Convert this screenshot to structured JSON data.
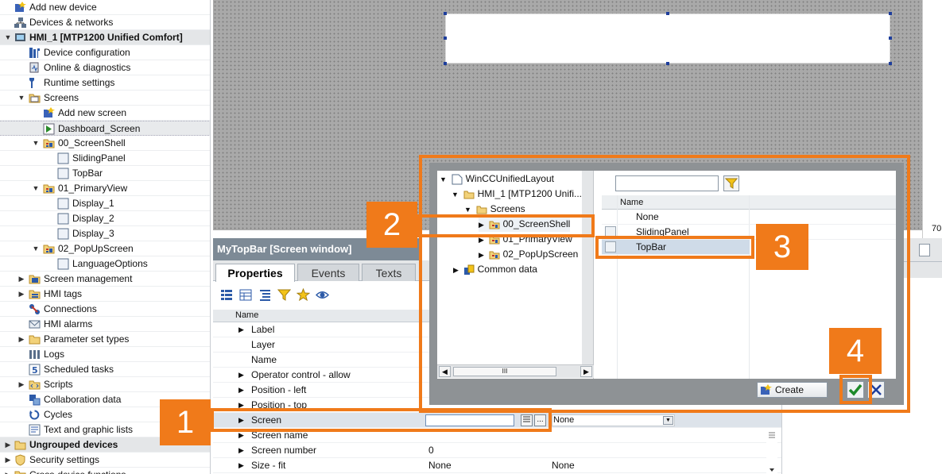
{
  "tree": {
    "items": [
      {
        "label": "Add new device",
        "icon": "add-device-icon"
      },
      {
        "label": "Devices & networks",
        "icon": "devices-networks-icon"
      },
      {
        "label": "HMI_1 [MTP1200 Unified Comfort]",
        "icon": "hmi-device-icon"
      },
      {
        "label": "Device configuration",
        "icon": "device-config-icon"
      },
      {
        "label": "Online & diagnostics",
        "icon": "diagnostics-icon"
      },
      {
        "label": "Runtime settings",
        "icon": "runtime-settings-icon"
      },
      {
        "label": "Screens",
        "icon": "folder-icon"
      },
      {
        "label": "Add new screen",
        "icon": "add-screen-icon"
      },
      {
        "label": "Dashboard_Screen",
        "icon": "screen-start-icon"
      },
      {
        "label": "00_ScreenShell",
        "icon": "screen-group-icon"
      },
      {
        "label": "SlidingPanel",
        "icon": "screen-icon"
      },
      {
        "label": "TopBar",
        "icon": "screen-icon"
      },
      {
        "label": "01_PrimaryView",
        "icon": "screen-group-icon"
      },
      {
        "label": "Display_1",
        "icon": "screen-icon"
      },
      {
        "label": "Display_2",
        "icon": "screen-icon"
      },
      {
        "label": "Display_3",
        "icon": "screen-icon"
      },
      {
        "label": "02_PopUpScreen",
        "icon": "screen-group-icon"
      },
      {
        "label": "LanguageOptions",
        "icon": "screen-icon"
      },
      {
        "label": "Screen management",
        "icon": "screen-management-icon"
      },
      {
        "label": "HMI tags",
        "icon": "hmi-tags-icon"
      },
      {
        "label": "Connections",
        "icon": "connections-icon"
      },
      {
        "label": "HMI alarms",
        "icon": "hmi-alarms-icon"
      },
      {
        "label": "Parameter set types",
        "icon": "folder-icon"
      },
      {
        "label": "Logs",
        "icon": "logs-icon"
      },
      {
        "label": "Scheduled tasks",
        "icon": "scheduled-tasks-icon"
      },
      {
        "label": "Scripts",
        "icon": "scripts-icon"
      },
      {
        "label": "Collaboration data",
        "icon": "collaboration-icon"
      },
      {
        "label": "Cycles",
        "icon": "cycles-icon"
      },
      {
        "label": "Text and graphic lists",
        "icon": "text-lists-icon"
      },
      {
        "label": "Ungrouped devices",
        "icon": "ungrouped-devices-icon"
      },
      {
        "label": "Security settings",
        "icon": "security-icon"
      },
      {
        "label": "Cross-device functions",
        "icon": "cross-device-icon"
      }
    ]
  },
  "canvas": {
    "zoom_text": "70"
  },
  "inspector": {
    "title": "MyTopBar [Screen window]",
    "tabs": [
      "Properties",
      "Events",
      "Texts"
    ],
    "col_name": "Name",
    "props": [
      {
        "name": "Label",
        "v1": "",
        "v2": ""
      },
      {
        "name": "Layer",
        "v1": "",
        "v2": ""
      },
      {
        "name": "Name",
        "v1": "",
        "v2": ""
      },
      {
        "name": "Operator control - allow",
        "v1": "",
        "v2": ""
      },
      {
        "name": "Position - left",
        "v1": "",
        "v2": ""
      },
      {
        "name": "Position - top",
        "v1": "",
        "v2": ""
      },
      {
        "name": "Screen",
        "v1": "",
        "v2": "None"
      },
      {
        "name": "Screen name",
        "v1": "",
        "v2": ""
      },
      {
        "name": "Screen number",
        "v1": "0",
        "v2": ""
      },
      {
        "name": "Size - fit",
        "v1": "None",
        "v2": "None"
      }
    ],
    "ellipsis": "..."
  },
  "popup": {
    "tree": [
      {
        "label": "WinCCUnifiedLayout"
      },
      {
        "label": "HMI_1 [MTP1200 Unifi..."
      },
      {
        "label": "Screens"
      },
      {
        "label": "00_ScreenShell"
      },
      {
        "label": "01_PrimaryView"
      },
      {
        "label": "02_PopUpScreen"
      },
      {
        "label": "Common data"
      }
    ],
    "col_name": "Name",
    "items": [
      "None",
      "SlidingPanel",
      "TopBar"
    ],
    "create_label": "Create",
    "scroll_thumb": "III"
  },
  "callouts": [
    "1",
    "2",
    "3",
    "4"
  ],
  "colors": {
    "accent": "#f07a1a",
    "title_bar": "#7d8a96"
  }
}
